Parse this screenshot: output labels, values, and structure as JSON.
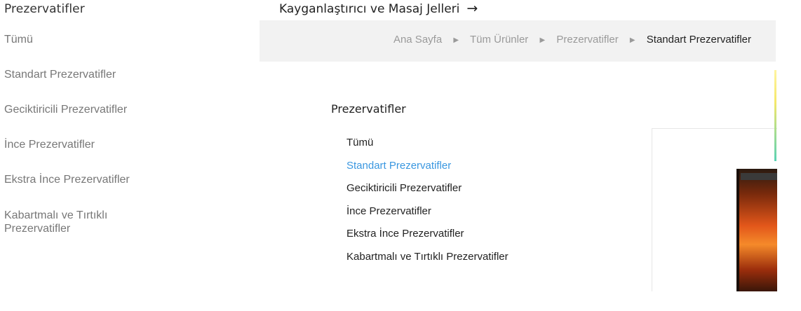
{
  "sidebar": {
    "title": "Prezervatifler",
    "items": [
      {
        "label": "Tümü"
      },
      {
        "label": "Standart Prezervatifler"
      },
      {
        "label": "Geciktiricili Prezervatifler"
      },
      {
        "label": "İnce Prezervatifler"
      },
      {
        "label": "Ekstra İnce Prezervatifler"
      },
      {
        "label": "Kabartmalı ve Tırtıklı Prezervatifler"
      }
    ]
  },
  "topmenu": {
    "label": "Kayganlaştırıcı ve Masaj Jelleri",
    "arrow": "→"
  },
  "breadcrumb": {
    "items": [
      "Ana Sayfa",
      "Tüm Ürünler",
      "Prezervatifler",
      "Standart Prezervatifler"
    ],
    "separator": "▶"
  },
  "panel": {
    "title": "Prezervatifler",
    "items": [
      {
        "label": "Tümü",
        "active": false
      },
      {
        "label": "Standart Prezervatifler",
        "active": true
      },
      {
        "label": "Geciktiricili Prezervatifler",
        "active": false
      },
      {
        "label": "İnce Prezervatifler",
        "active": false
      },
      {
        "label": "Ekstra İnce Prezervatifler",
        "active": false
      },
      {
        "label": "Kabartmalı ve Tırtıklı Prezervatifler",
        "active": false
      }
    ]
  },
  "colors": {
    "active_link": "#3a97e0",
    "breadcrumb_bg": "#f2f2f2",
    "muted_text": "#777777"
  }
}
